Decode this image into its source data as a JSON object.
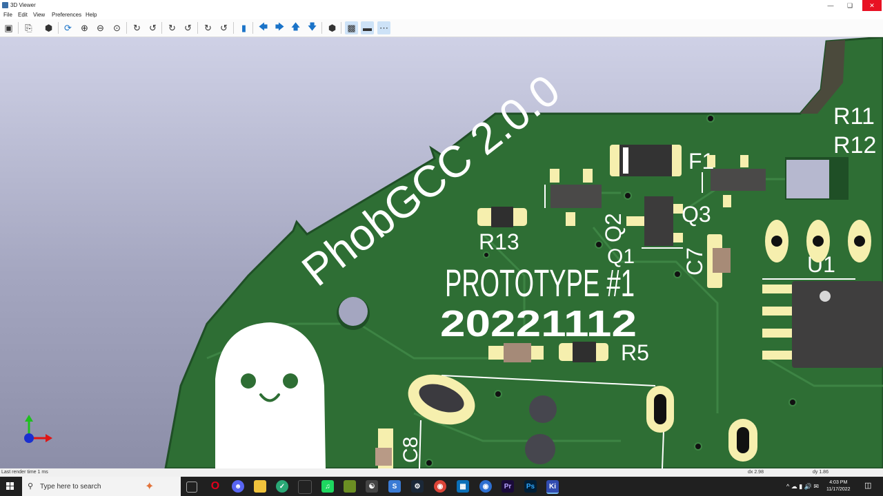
{
  "window": {
    "title": "3D Viewer"
  },
  "menu": [
    "File",
    "Edit",
    "View",
    "Preferences",
    "Help"
  ],
  "toolbar": {
    "icons": [
      "render-options-icon",
      "copy-image-icon",
      "raytracing-icon",
      "reload-icon",
      "zoom-in-icon",
      "zoom-out-icon",
      "zoom-fit-icon",
      "rotate-x-cw-icon",
      "rotate-x-ccw-icon",
      "rotate-y-cw-icon",
      "rotate-y-ccw-icon",
      "rotate-z-cw-icon",
      "rotate-z-ccw-icon",
      "flip-board-icon",
      "pan-left-icon",
      "pan-right-icon",
      "pan-up-icon",
      "pan-down-icon",
      "ortho-toggle-icon",
      "body-style-icon",
      "board-body-icon",
      "dashed-grid-icon"
    ]
  },
  "board": {
    "project_name": "PhobGCC 2.0.0",
    "prototype_label": "PROTOTYPE #1",
    "date_label": "20221112",
    "refdes": {
      "r11": "R11",
      "r12": "R12",
      "f1": "F1",
      "q3": "Q3",
      "q2": "Q2",
      "q1": "Q1",
      "r13": "R13",
      "c7": "C7",
      "u1": "U1",
      "r5": "R5",
      "c8": "C8"
    }
  },
  "status": {
    "render_time": "Last render time 1 ms",
    "dx": "dx 2.98",
    "dy": "dy 1.86"
  },
  "taskbar": {
    "search_placeholder": "Type here to search",
    "time": "4:03 PM",
    "date": "11/17/2022",
    "apps": [
      "Opera",
      "Discord",
      "File Explorer",
      "GeForce",
      "Spotify",
      "Minecraft",
      "Steam",
      "Chrome",
      "Photos",
      "Premiere",
      "Photoshop",
      "KiCad"
    ]
  },
  "colors": {
    "pcb": "#2e6e34",
    "silkscreen": "#ffffff",
    "pad": "#f6efae",
    "component": "#3c3b3b",
    "background_top": "#cfd1e6",
    "background_bottom": "#8c8ea8"
  }
}
